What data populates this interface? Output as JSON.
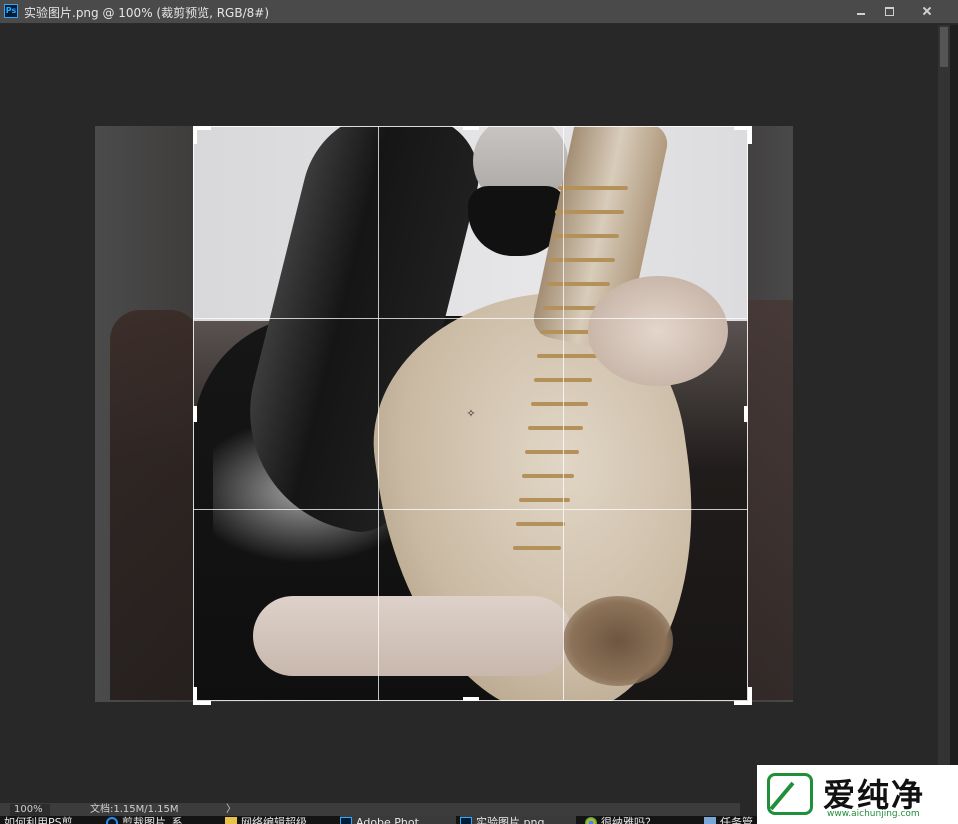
{
  "window": {
    "app_icon_text": "Ps",
    "document_title": "实验图片.png @ 100% (裁剪预览, RGB/8#)"
  },
  "status_bar": {
    "zoom": "100%",
    "doc_size": "文档:1.15M/1.15M",
    "arrow": "〉"
  },
  "taskbar": {
    "items": [
      {
        "label": "如何利用PS剪",
        "icon": "none"
      },
      {
        "label": "剪裁图片_系",
        "icon": "ie-icon"
      },
      {
        "label": "网络编辑超级",
        "icon": "folder-icon"
      },
      {
        "label": "Adobe Phot",
        "icon": "ps-icon",
        "active": true
      },
      {
        "label": "实验图片.png",
        "icon": "ps-icon",
        "active": true
      },
      {
        "label": "很纳雅吗？",
        "icon": "chrome-icon"
      },
      {
        "label": "任务管",
        "icon": "task-manager-icon"
      }
    ]
  },
  "watermark": {
    "brand": "爱纯净",
    "url": "www.aichunjing.com"
  },
  "colors": {
    "ps_blue": "#31a8ff",
    "ps_dark": "#001e36",
    "workspace_bg": "#282828",
    "watermark_green": "#1f8f3a"
  }
}
